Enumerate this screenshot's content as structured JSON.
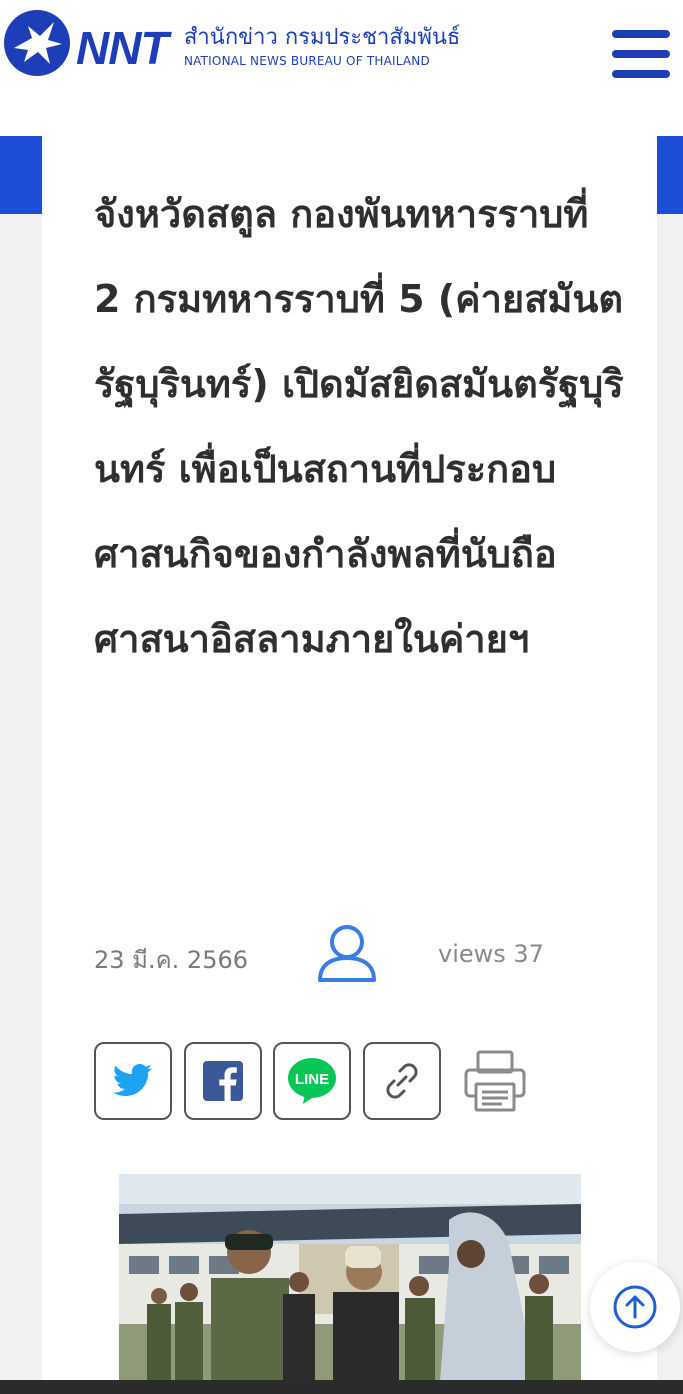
{
  "header": {
    "logo_text": "NNT",
    "org_name_th": "สำนักข่าว กรมประชาสัมพันธ์",
    "org_name_en": "NATIONAL NEWS BUREAU OF THAILAND",
    "brand_color": "#1e3eb8",
    "menu_icon": "hamburger-menu-icon"
  },
  "article": {
    "title": "จังหวัดสตูล กองพันทหารราบที่ 2 กรมทหารราบที่ 5 (ค่ายสมันตรัฐบุรินทร์) เปิดมัสยิดสมันตรัฐบุรินทร์ เพื่อเป็นสถานที่ประกอบศาสนกิจของกำลังพลที่นับถือศาสนาอิสลามภายในค่ายฯ",
    "date": "23 มี.ค. 2566",
    "views_label": "views 37",
    "author_icon": "user-icon"
  },
  "share": {
    "twitter_icon": "twitter-icon",
    "facebook_icon": "facebook-icon",
    "line_label": "LINE",
    "link_icon": "link-icon",
    "print_icon": "printer-icon"
  },
  "colors": {
    "accent_blue": "#1d4ed8",
    "twitter": "#1da1f2",
    "facebook": "#3b5998",
    "line": "#06c755"
  },
  "scroll_top_icon": "arrow-up-circle-icon"
}
